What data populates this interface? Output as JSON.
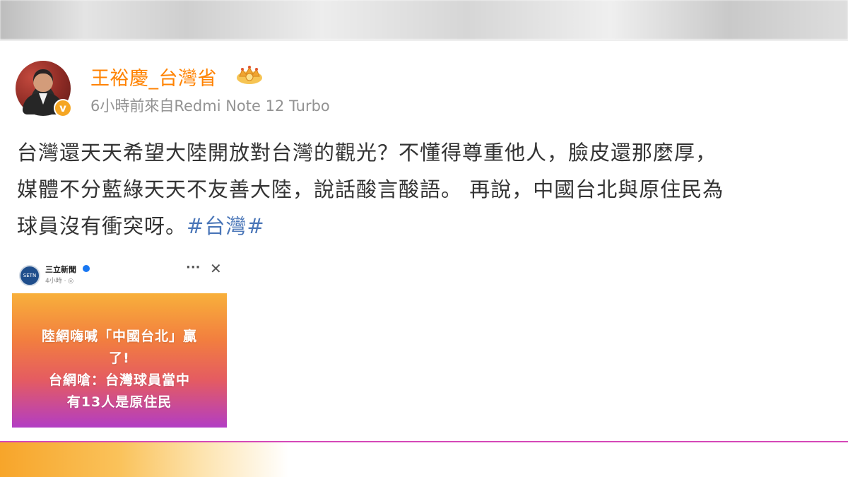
{
  "post": {
    "username": "王裕慶_台灣省",
    "meta": "6小時前來自Redmi Note 12 Turbo",
    "verified_symbol": "v",
    "body_lines": [
      "台灣還天天希望大陸開放對台灣的觀光？不懂得尊重他人，臉皮還那麼厚，",
      "媒體不分藍綠天天不友善大陸，說話酸言酸語。 再說，中國台北與原住民為",
      "球員沒有衝突呀。"
    ],
    "hashtag": "#台灣#"
  },
  "embed": {
    "source": "三立新聞",
    "time": "4小時 · ◎",
    "logo_text": "SETN",
    "graphic_lines": [
      "陸網嗨喊「中國台北」贏",
      "了!",
      "台網嗆：台灣球員當中",
      "有13人是原住民"
    ]
  },
  "colors": {
    "username": "#ff8200",
    "hashtag": "#4a76b8",
    "body_text": "#333333",
    "meta_text": "#939393",
    "badge": "#f5a623",
    "divider": "#d548b8"
  },
  "icons": [
    "crown-icon",
    "verified-icon",
    "more-icon",
    "close-icon",
    "check-icon"
  ]
}
